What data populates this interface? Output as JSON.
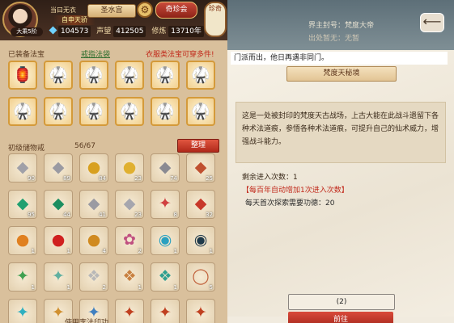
{
  "player": {
    "name": "当曰无衣",
    "title": "自申天骄",
    "avatar_level": "大乘5阶"
  },
  "header": {
    "sect": "圣水宫",
    "treasure_button": "奇珍会",
    "logo_text": "珍奇"
  },
  "stats": [
    {
      "icon": "gem-icon",
      "label": "",
      "value": "104573"
    },
    {
      "icon": "",
      "label": "声望",
      "value": "412505"
    },
    {
      "icon": "",
      "label": "修炼",
      "value": "13710年"
    }
  ],
  "equipment": {
    "title": "已装备法宝",
    "ring_link": "戒指法袋",
    "warning": "衣服类法宝可穿多件!",
    "items": [
      {
        "glyph": "🏮",
        "color": "#c9384a"
      },
      {
        "glyph": "🥋",
        "color": "#3a9e6a"
      },
      {
        "glyph": "🥋",
        "color": "#3a9e6a"
      },
      {
        "glyph": "🥋",
        "color": "#3a9e6a"
      },
      {
        "glyph": "🥋",
        "color": "#3a9e6a"
      },
      {
        "glyph": "🥋",
        "color": "#3a9e6a"
      },
      {
        "glyph": "🥋",
        "color": "#3a9e6a"
      },
      {
        "glyph": "🥋",
        "color": "#3a9e6a"
      },
      {
        "glyph": "🥋",
        "color": "#3a9e6a"
      },
      {
        "glyph": "🥋",
        "color": "#3a9e6a"
      },
      {
        "glyph": "🥋",
        "color": "#3a9e6a"
      },
      {
        "glyph": "🥋",
        "color": "#3a9e6a"
      }
    ]
  },
  "storage": {
    "title": "初级储物戒",
    "capacity": "56/67",
    "sort_button": "整理",
    "items": [
      {
        "glyph": "◆",
        "color": "#a0a0a8",
        "count": "90"
      },
      {
        "glyph": "◆",
        "color": "#9a9aa2",
        "count": "89"
      },
      {
        "glyph": "●",
        "color": "#d8a020",
        "count": "84"
      },
      {
        "glyph": "●",
        "color": "#e0b030",
        "count": "23"
      },
      {
        "glyph": "◆",
        "color": "#8a8a92",
        "count": "74"
      },
      {
        "glyph": "◆",
        "color": "#c05030",
        "count": "25"
      },
      {
        "glyph": "◆",
        "color": "#20a070",
        "count": "95"
      },
      {
        "glyph": "◆",
        "color": "#1c8e60",
        "count": "44"
      },
      {
        "glyph": "◆",
        "color": "#9a9aa2",
        "count": "41"
      },
      {
        "glyph": "◆",
        "color": "#a6a6ae",
        "count": "23"
      },
      {
        "glyph": "✦",
        "color": "#d04040",
        "count": "8"
      },
      {
        "glyph": "◆",
        "color": "#c8382a",
        "count": "32"
      },
      {
        "glyph": "●",
        "color": "#e08020",
        "count": "1"
      },
      {
        "glyph": "●",
        "color": "#d02020",
        "count": "1"
      },
      {
        "glyph": "●",
        "color": "#d08a20",
        "count": "4"
      },
      {
        "glyph": "✿",
        "color": "#c05080",
        "count": "2"
      },
      {
        "glyph": "◉",
        "color": "#2aa0c0",
        "count": "1"
      },
      {
        "glyph": "◉",
        "color": "#203a4a",
        "count": "1"
      },
      {
        "glyph": "✦",
        "color": "#40a050",
        "count": "1"
      },
      {
        "glyph": "✦",
        "color": "#60b0a0",
        "count": "1"
      },
      {
        "glyph": "❖",
        "color": "#b8b8b8",
        "count": "2"
      },
      {
        "glyph": "❖",
        "color": "#c88040",
        "count": "1"
      },
      {
        "glyph": "❖",
        "color": "#30a090",
        "count": "1"
      },
      {
        "glyph": "◯",
        "color": "#c0603a",
        "count": "5"
      },
      {
        "glyph": "✦",
        "color": "#30b0c0",
        "count": ""
      },
      {
        "glyph": "✦",
        "color": "#d09030",
        "count": ""
      },
      {
        "glyph": "✦",
        "color": "#4080c0",
        "count": ""
      },
      {
        "glyph": "✦",
        "color": "#c04020",
        "count": ""
      },
      {
        "glyph": "✦",
        "color": "#c04020",
        "count": ""
      },
      {
        "glyph": "✦",
        "color": "#c04020",
        "count": ""
      }
    ],
    "bottom_text": "使用李法印功"
  },
  "right": {
    "lord_label": "界主封号：梵度大帝",
    "appears_label": "出处暂无：无暂",
    "quote": "门派而出，他日再遇非同门。",
    "dungeon_title": "梵度天秘境",
    "description": "这是一处被封印的梵度天古战场，上古大能在此战斗遗留下各种术法道痕，参悟各种术法道痕，可提升自己的仙术威力，增强战斗能力。",
    "remaining": "剩余进入次数：1",
    "promotion": "【每百年自动增加1次进入次数】",
    "merit": "每天首次探索需要功德：20",
    "button_count": "(2)",
    "button_enter": "前往"
  }
}
